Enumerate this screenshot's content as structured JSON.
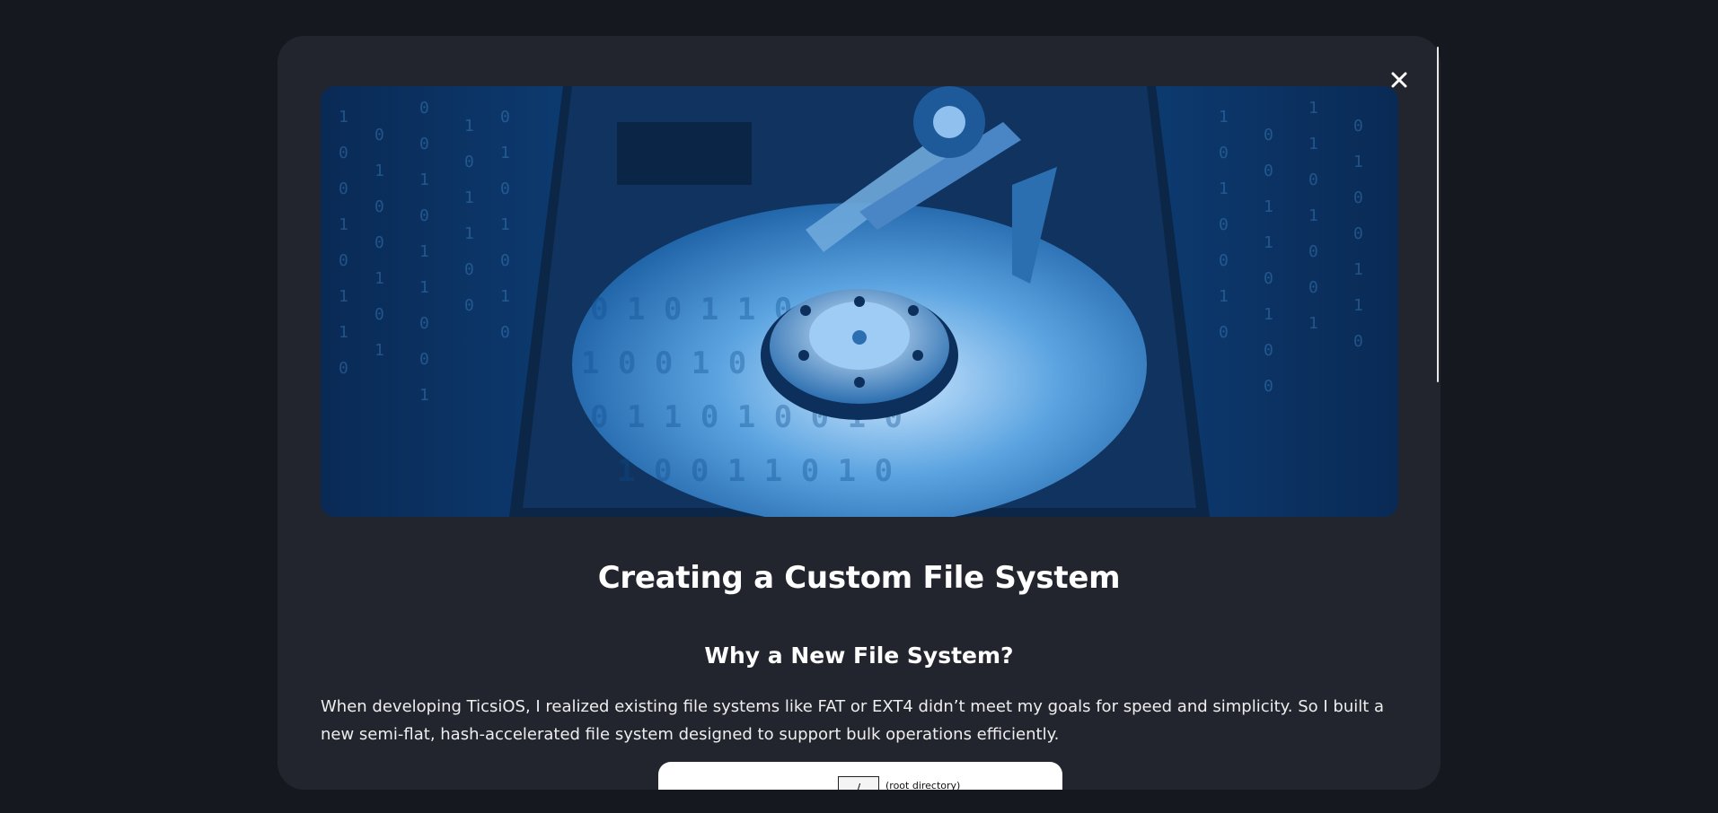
{
  "modal": {
    "close_icon": "close-icon",
    "hero_image": "hard-drive-binary-image",
    "title": "Creating a Custom File System",
    "section_heading": "Why a New File System?",
    "paragraph": "When developing TicsiOS, I realized existing file systems like FAT or EXT4 didn’t meet my goals for speed and simplicity. So I built a new semi-flat, hash-accelerated file system designed to support bulk operations efficiently.",
    "diagram": {
      "root_box_text": "/",
      "root_label": "(root directory)"
    }
  },
  "colors": {
    "page_bg": "#161820",
    "modal_bg": "#23252e",
    "hero_blue": "#1a6fc0"
  }
}
